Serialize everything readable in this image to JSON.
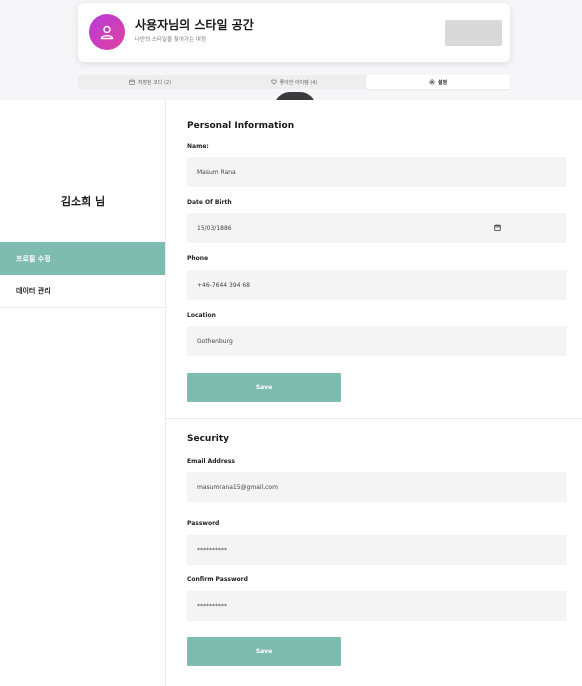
{
  "header": {
    "title": "사용자님의 스타일 공간",
    "subtitle": "나만의 스타일을 찾아가는 여정"
  },
  "tabs": [
    {
      "label": "저장된 코디 (2)",
      "icon": "calendar-icon",
      "active": false
    },
    {
      "label": "좋아한 아이템 (4)",
      "icon": "heart-icon",
      "active": false
    },
    {
      "label": "설정",
      "icon": "gear-icon",
      "active": true
    }
  ],
  "sidebar": {
    "user_name": "김소희 님",
    "items": [
      {
        "label": "프로필 수정",
        "active": true
      },
      {
        "label": "데이터 관리",
        "active": false
      }
    ]
  },
  "personal": {
    "title": "Personal Information",
    "name_label": "Name:",
    "name_value": "Masum Rana",
    "dob_label": "Date Of Birth",
    "dob_value": "15/03/1886",
    "phone_label": "Phone",
    "phone_value": "+46-7644 394 68",
    "location_label": "Location",
    "location_value": "Gothenburg",
    "save_label": "Save"
  },
  "security": {
    "title": "Security",
    "email_label": "Email Address",
    "email_value": "masumrana15@gmail.com",
    "password_label": "Password",
    "password_value": "**********",
    "confirm_label": "Confirm Password",
    "confirm_value": "**********",
    "save_label": "Save"
  },
  "colors": {
    "accent": "#7ebcaf",
    "avatar_gradient_start": "#b63bd8",
    "avatar_gradient_end": "#e042a0"
  }
}
